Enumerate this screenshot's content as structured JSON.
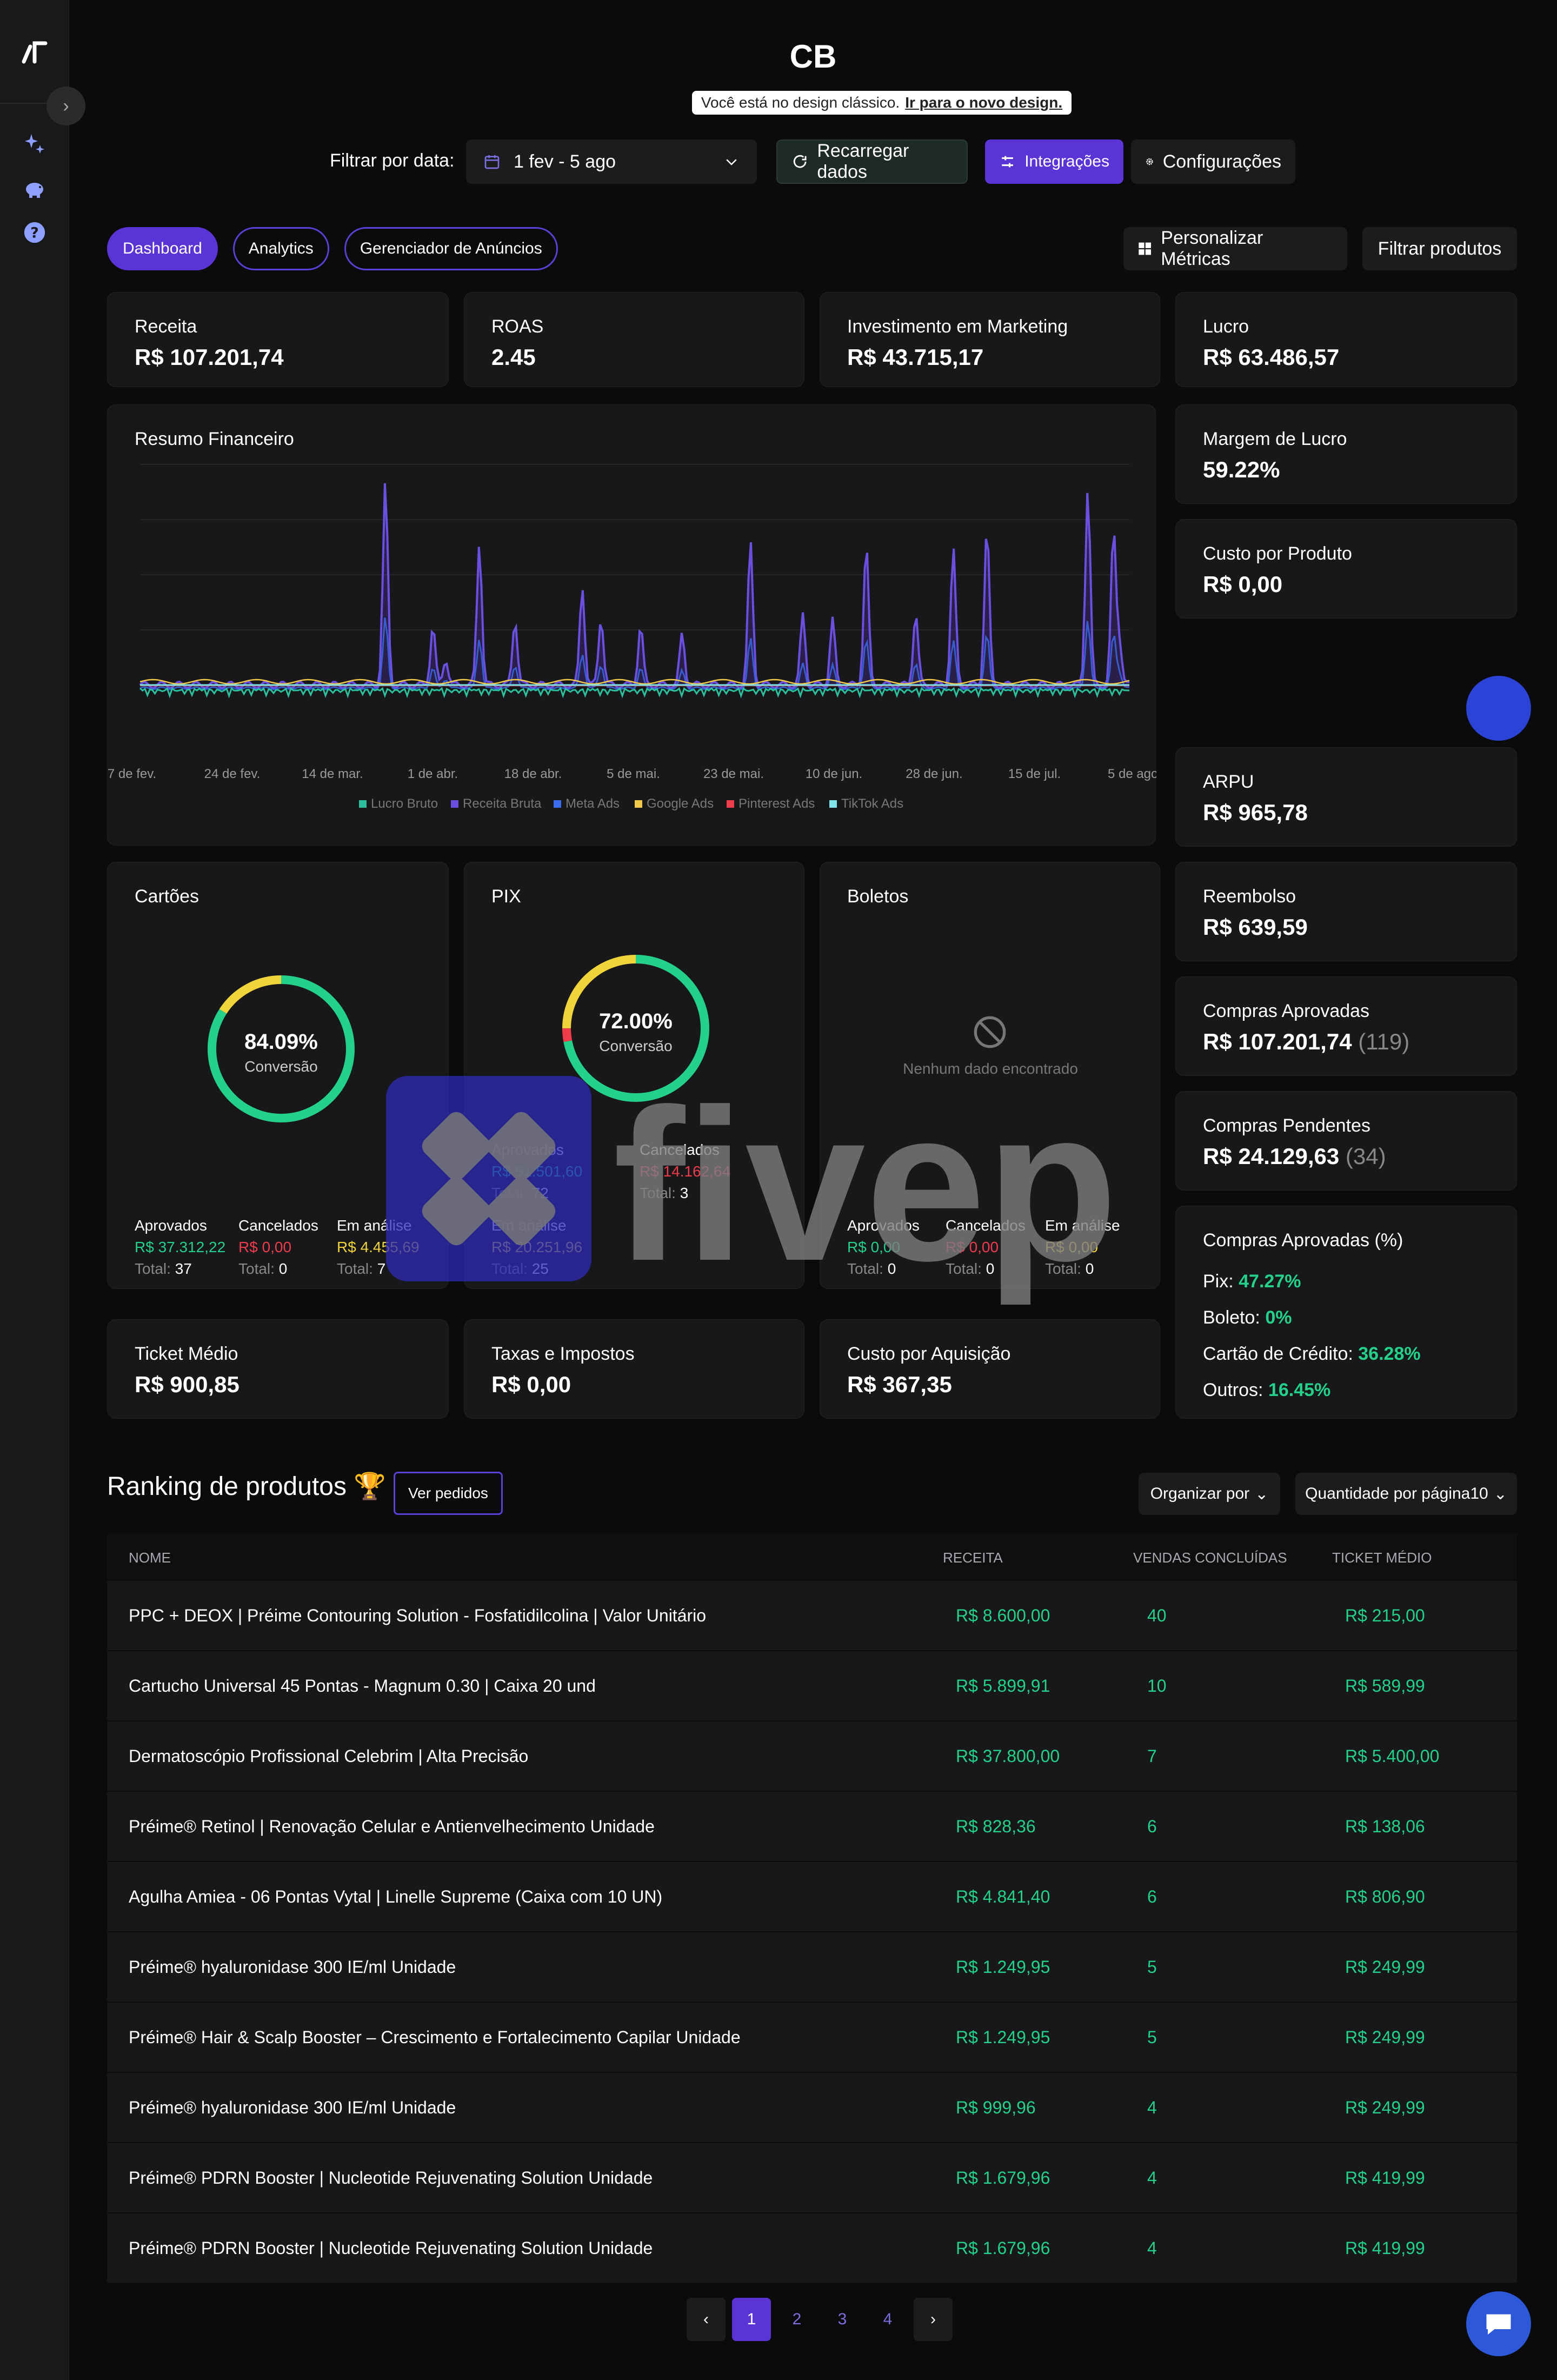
{
  "brand": "CB",
  "notice": {
    "text": "Você está no design clássico.",
    "link": "Ir para o novo design."
  },
  "filter": {
    "label": "Filtrar por data:",
    "range": "1 fev - 5 ago"
  },
  "buttons": {
    "reload": "Recarregar dados",
    "integrations": "Integrações",
    "config": "Configurações",
    "metrics": "Personalizar Métricas",
    "filter_products": "Filtrar produtos"
  },
  "tabs": [
    "Dashboard",
    "Analytics",
    "Gerenciador de Anúncios"
  ],
  "kpi": {
    "receita": {
      "label": "Receita",
      "value": "R$ 107.201,74"
    },
    "roas": {
      "label": "ROAS",
      "value": "2.45"
    },
    "investimento": {
      "label": "Investimento em Marketing",
      "value": "R$ 43.715,17"
    },
    "lucro": {
      "label": "Lucro",
      "value": "R$ 63.486,57"
    },
    "margem": {
      "label": "Margem de Lucro",
      "value": "59.22%"
    },
    "custo_produto": {
      "label": "Custo por Produto",
      "value": "R$ 0,00"
    },
    "arpu": {
      "label": "ARPU",
      "value": "R$ 965,78"
    },
    "reembolso": {
      "label": "Reembolso",
      "value": "R$ 639,59"
    },
    "aprovadas": {
      "label": "Compras Aprovadas",
      "value": "R$ 107.201,74",
      "count": "(119)"
    },
    "pendentes": {
      "label": "Compras Pendentes",
      "value": "R$ 24.129,63",
      "count": "(34)"
    },
    "aprovadas_pct": {
      "label": "Compras Aprovadas (%)",
      "pix_label": "Pix:",
      "pix": "47.27%",
      "boleto_label": "Boleto:",
      "boleto": "0%",
      "cartao_label": "Cartão de Crédito:",
      "cartao": "36.28%",
      "outros_label": "Outros:",
      "outros": "16.45%"
    },
    "ticket": {
      "label": "Ticket Médio",
      "value": "R$ 900,85"
    },
    "taxas": {
      "label": "Taxas e Impostos",
      "value": "R$ 0,00"
    },
    "cac": {
      "label": "Custo por Aquisição",
      "value": "R$ 367,35"
    }
  },
  "chart_data": {
    "type": "line",
    "title": "Resumo Financeiro",
    "x_ticks": [
      "7 de fev.",
      "24 de fev.",
      "14 de mar.",
      "1 de abr.",
      "18 de abr.",
      "5 de mai.",
      "23 de mai.",
      "10 de jun.",
      "28 de jun.",
      "15 de jul.",
      "5 de ago."
    ],
    "legend": [
      {
        "name": "Lucro Bruto",
        "color": "#2bbf9c"
      },
      {
        "name": "Receita Bruta",
        "color": "#6a4fe0"
      },
      {
        "name": "Meta Ads",
        "color": "#3b6cf0"
      },
      {
        "name": "Google Ads",
        "color": "#f0c84a"
      },
      {
        "name": "Pinterest Ads",
        "color": "#f03b4b"
      },
      {
        "name": "TikTok Ads",
        "color": "#7fe3e8"
      }
    ],
    "spikes": [
      [
        0.248,
        0.92
      ],
      [
        0.296,
        0.27
      ],
      [
        0.309,
        0.12
      ],
      [
        0.343,
        0.65
      ],
      [
        0.379,
        0.3
      ],
      [
        0.447,
        0.45
      ],
      [
        0.466,
        0.31
      ],
      [
        0.506,
        0.27
      ],
      [
        0.548,
        0.23
      ],
      [
        0.617,
        0.65
      ],
      [
        0.67,
        0.32
      ],
      [
        0.7,
        0.3
      ],
      [
        0.734,
        0.64
      ],
      [
        0.784,
        0.33
      ],
      [
        0.822,
        0.62
      ],
      [
        0.856,
        0.72
      ],
      [
        0.958,
        0.9
      ],
      [
        0.984,
        0.7
      ],
      [
        0.99,
        0.2
      ]
    ]
  },
  "payments": {
    "cartoes": {
      "title": "Cartões",
      "pct": "84.09%",
      "sub": "Conversão",
      "approved_label": "Aprovados",
      "approved": "R$ 37.312,22",
      "approved_total": "37",
      "cancel_label": "Cancelados",
      "cancel": "R$ 0,00",
      "cancel_total": "0",
      "analysis_label": "Em análise",
      "analysis": "R$ 4.455,69",
      "analysis_total": "7",
      "total_label": "Total:"
    },
    "pix": {
      "title": "PIX",
      "pct": "72.00%",
      "sub": "Conversão",
      "approved_label": "Aprovados",
      "approved": "R$ 51.501,60",
      "approved_total": "72",
      "cancel_label": "Cancelados",
      "cancel": "R$ 14.162,64",
      "cancel_total": "3",
      "analysis_label": "Em análise",
      "analysis": "R$ 20.251,96",
      "analysis_total": "25",
      "total_label": "Total:"
    },
    "boletos": {
      "title": "Boletos",
      "empty": "Nenhum dado encontrado",
      "approved_label": "Aprovados",
      "approved": "R$ 0,00",
      "approved_total": "0",
      "cancel_label": "Cancelados",
      "cancel": "R$ 0,00",
      "cancel_total": "0",
      "analysis_label": "Em análise",
      "analysis": "R$ 0,00",
      "analysis_total": "0",
      "total_label": "Total:"
    }
  },
  "ranking": {
    "title": "Ranking de produtos 🏆",
    "orders_button": "Ver pedidos",
    "sort": "Organizar por",
    "per_page": "Quantidade por página10",
    "columns": [
      "NOME",
      "RECEITA",
      "VENDAS CONCLUÍDAS",
      "TICKET MÉDIO"
    ],
    "rows": [
      {
        "name": "PPC + DEOX | Préime Contouring Solution - Fosfatidilcolina | Valor Unitário",
        "revenue": "R$ 8.600,00",
        "sales": "40",
        "ticket": "R$ 215,00"
      },
      {
        "name": "Cartucho Universal 45 Pontas - Magnum 0.30 | Caixa 20 und",
        "revenue": "R$ 5.899,91",
        "sales": "10",
        "ticket": "R$ 589,99"
      },
      {
        "name": "Dermatoscópio Profissional Celebrim | Alta Precisão",
        "revenue": "R$ 37.800,00",
        "sales": "7",
        "ticket": "R$ 5.400,00"
      },
      {
        "name": "Préime® Retinol | Renovação Celular e Antienvelhecimento Unidade",
        "revenue": "R$ 828,36",
        "sales": "6",
        "ticket": "R$ 138,06"
      },
      {
        "name": "Agulha Amiea - 06 Pontas Vytal | Linelle Supreme (Caixa com 10 UN)",
        "revenue": "R$ 4.841,40",
        "sales": "6",
        "ticket": "R$ 806,90"
      },
      {
        "name": "Préime® hyaluronidase 300 IE/ml Unidade",
        "revenue": "R$ 1.249,95",
        "sales": "5",
        "ticket": "R$ 249,99"
      },
      {
        "name": "Préime® Hair & Scalp Booster – Crescimento e Fortalecimento Capilar Unidade",
        "revenue": "R$ 1.249,95",
        "sales": "5",
        "ticket": "R$ 249,99"
      },
      {
        "name": "Préime® hyaluronidase 300 IE/ml Unidade",
        "revenue": "R$ 999,96",
        "sales": "4",
        "ticket": "R$ 249,99"
      },
      {
        "name": "Préime® PDRN Booster | Nucleotide Rejuvenating Solution Unidade",
        "revenue": "R$ 1.679,96",
        "sales": "4",
        "ticket": "R$ 419,99"
      },
      {
        "name": "Préime® PDRN Booster | Nucleotide Rejuvenating Solution Unidade",
        "revenue": "R$ 1.679,96",
        "sales": "4",
        "ticket": "R$ 419,99"
      }
    ]
  },
  "pagination": [
    "1",
    "2",
    "3",
    "4"
  ],
  "watermark": "fivep"
}
